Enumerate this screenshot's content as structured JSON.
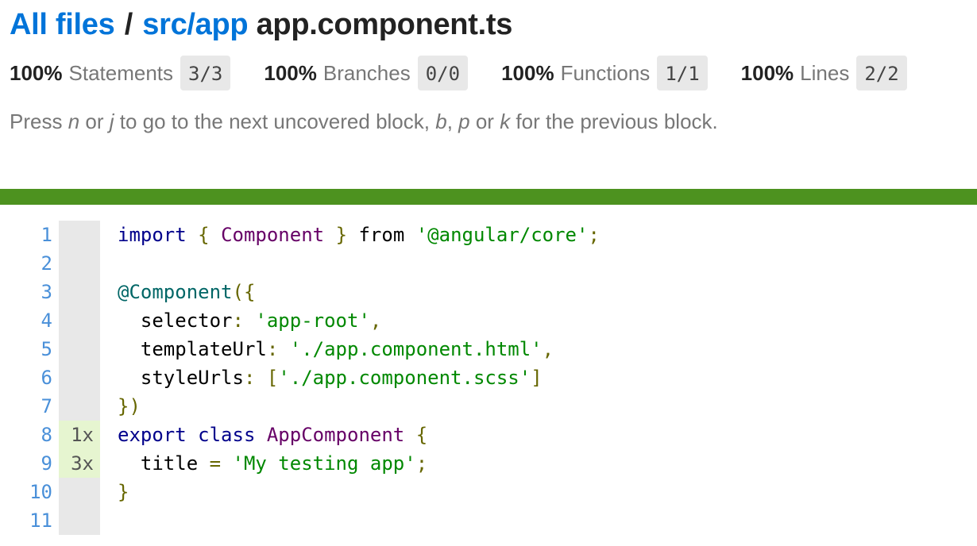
{
  "breadcrumb": {
    "all_files": "All files",
    "separator": "/",
    "folder": "src/app",
    "file": "app.component.ts"
  },
  "stats": [
    {
      "pct": "100%",
      "label": "Statements",
      "frac": "3/3"
    },
    {
      "pct": "100%",
      "label": "Branches",
      "frac": "0/0"
    },
    {
      "pct": "100%",
      "label": "Functions",
      "frac": "1/1"
    },
    {
      "pct": "100%",
      "label": "Lines",
      "frac": "2/2"
    }
  ],
  "hint": {
    "t1": "Press ",
    "k1": "n",
    "t2": " or ",
    "k2": "j",
    "t3": " to go to the next uncovered block, ",
    "k3": "b",
    "t4": ", ",
    "k4": "p",
    "t5": " or ",
    "k5": "k",
    "t6": " for the previous block."
  },
  "colors": {
    "coverage_bar": "#4d921f",
    "link": "#0074D9",
    "line_number": "#4a90d9",
    "hit_background": "#e6f5d0"
  },
  "line_numbers": [
    "1",
    "2",
    "3",
    "4",
    "5",
    "6",
    "7",
    "8",
    "9",
    "10",
    "11"
  ],
  "hit_counts": [
    "",
    "",
    "",
    "",
    "",
    "",
    "",
    "1x",
    "3x",
    "",
    ""
  ],
  "code": {
    "l1": {
      "a": "import",
      "b": " ",
      "c": "{",
      "d": " ",
      "e": "Component",
      "f": " ",
      "g": "}",
      "h": " from ",
      "i": "'@angular/core'",
      "j": ";"
    },
    "l3": {
      "a": "@Component",
      "b": "({"
    },
    "l4": {
      "a": "  selector",
      "b": ": ",
      "c": "'app-root'",
      "d": ","
    },
    "l5": {
      "a": "  templateUrl",
      "b": ": ",
      "c": "'./app.component.html'",
      "d": ","
    },
    "l6": {
      "a": "  styleUrls",
      "b": ": [",
      "c": "'./app.component.scss'",
      "d": "]"
    },
    "l7": {
      "a": "})"
    },
    "l8": {
      "a": "export",
      "b": " ",
      "c": "class",
      "d": " ",
      "e": "AppComponent",
      "f": " ",
      "g": "{"
    },
    "l9": {
      "a": "  title ",
      "b": "=",
      "c": " ",
      "d": "'My testing app'",
      "e": ";"
    },
    "l10": {
      "a": "}"
    }
  }
}
